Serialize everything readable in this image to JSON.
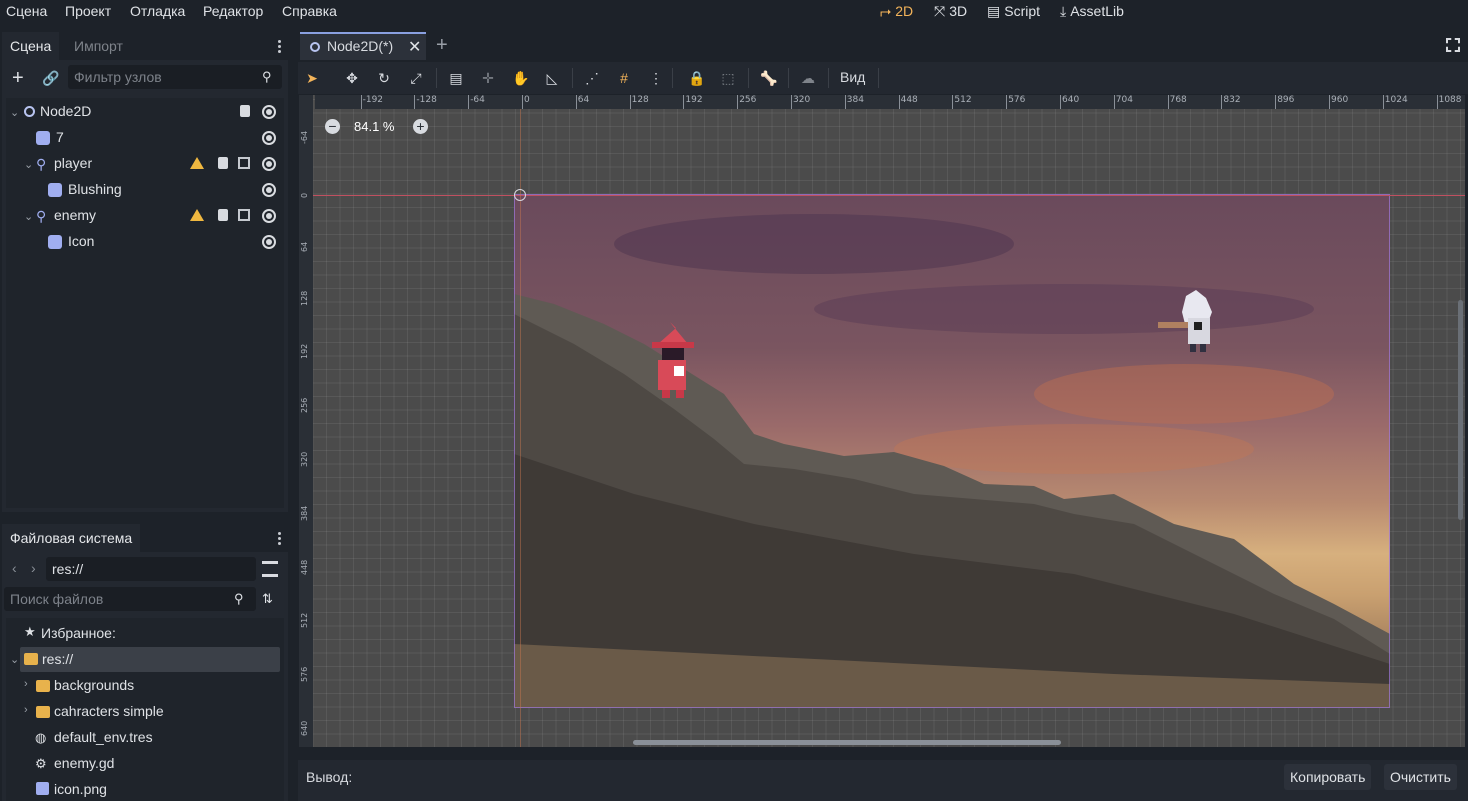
{
  "menu": {
    "items": [
      "Сцена",
      "Проект",
      "Отладка",
      "Редактор",
      "Справка"
    ],
    "workspaces": [
      {
        "label": "2D",
        "active": true
      },
      {
        "label": "3D",
        "active": false
      },
      {
        "label": "Script",
        "active": false
      },
      {
        "label": "AssetLib",
        "active": false
      }
    ]
  },
  "scene_dock": {
    "tabs": [
      "Сцена",
      "Импорт"
    ],
    "filter_placeholder": "Фильтр узлов",
    "tree": [
      {
        "label": "Node2D"
      },
      {
        "label": "7"
      },
      {
        "label": "player"
      },
      {
        "label": "Blushing"
      },
      {
        "label": "enemy"
      },
      {
        "label": "Icon"
      }
    ]
  },
  "fs_dock": {
    "title": "Файловая система",
    "path": "res://",
    "search_placeholder": "Поиск файлов",
    "favorites_label": "Избранное:",
    "items": [
      "res://",
      "backgrounds",
      "cahracters simple",
      "default_env.tres",
      "enemy.gd",
      "icon.png"
    ]
  },
  "editor": {
    "tab_label": "Node2D(*)",
    "view_label": "Вид",
    "zoom": "84.1 %",
    "ruler_x": [
      "-192",
      "-128",
      "-64",
      "0",
      "64",
      "128",
      "192",
      "256",
      "320",
      "384",
      "448",
      "512",
      "576",
      "640",
      "704",
      "768",
      "832",
      "896",
      "960",
      "1024",
      "1088"
    ],
    "ruler_y": [
      "-64",
      "0",
      "64",
      "128",
      "192",
      "256",
      "320",
      "384",
      "448",
      "512",
      "576",
      "640"
    ]
  },
  "output": {
    "label": "Вывод:",
    "copy_label": "Копировать",
    "clear_label": "Очистить"
  },
  "colors": {
    "accent": "#f3b45a",
    "warning": "#f0b840",
    "origin_line": "#c05060"
  }
}
